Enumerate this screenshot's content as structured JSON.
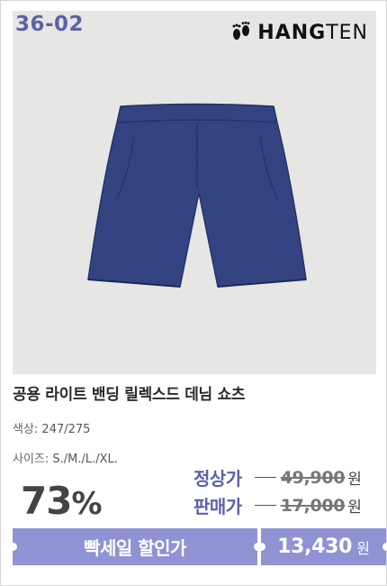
{
  "product": {
    "code": "36-02",
    "brand": "HANGTEN",
    "brand_bold": "HANG",
    "brand_light": "TEN",
    "name": "공용 라이트 밴딩 릴렉스드 데님 쇼츠"
  },
  "options": {
    "color_label": "색상",
    "color_value": ": 247/275",
    "size_label": "사이즈",
    "size_value": ": S./M./L./XL."
  },
  "pricing": {
    "discount": "73",
    "discount_sign": "%",
    "regular_label": "정상가",
    "regular_price": "49,900",
    "sale_label": "판매가",
    "sale_price": "17,000",
    "currency": "원"
  },
  "promo": {
    "label": "빡세일 할인가",
    "price": "13,430",
    "currency": "원"
  },
  "colors": {
    "accent": "#5b62a6",
    "bar": "#8f93d3",
    "photo_bg": "#e6e6e4",
    "denim": "#2f3f7c"
  },
  "icons": {
    "brand_logo": "footprints-icon"
  }
}
